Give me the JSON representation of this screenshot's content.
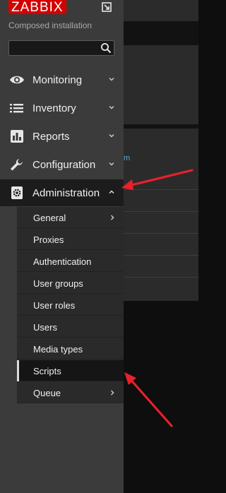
{
  "logo": {
    "text": "ZABBIX"
  },
  "subtitle": "Composed installation",
  "search": {
    "placeholder": "",
    "value": ""
  },
  "menu": [
    {
      "label": "Monitoring",
      "icon": "eye-icon"
    },
    {
      "label": "Inventory",
      "icon": "list-icon"
    },
    {
      "label": "Reports",
      "icon": "bar-chart-icon"
    },
    {
      "label": "Configuration",
      "icon": "wrench-icon"
    },
    {
      "label": "Administration",
      "icon": "gear-icon",
      "expanded": true
    }
  ],
  "submenu": [
    {
      "label": "General",
      "has_children": true
    },
    {
      "label": "Proxies"
    },
    {
      "label": "Authentication"
    },
    {
      "label": "User groups"
    },
    {
      "label": "User roles"
    },
    {
      "label": "Users"
    },
    {
      "label": "Media types"
    },
    {
      "label": "Scripts",
      "selected": true
    },
    {
      "label": "Queue",
      "has_children": true
    }
  ],
  "background_link_fragment": "m",
  "colors": {
    "logo_bg": "#d40000",
    "sidebar_bg": "#3b3b3b",
    "submenu_bg": "#2a2a2a",
    "active_bg": "#1c1c1c",
    "annotation_arrow": "#e8212b"
  }
}
